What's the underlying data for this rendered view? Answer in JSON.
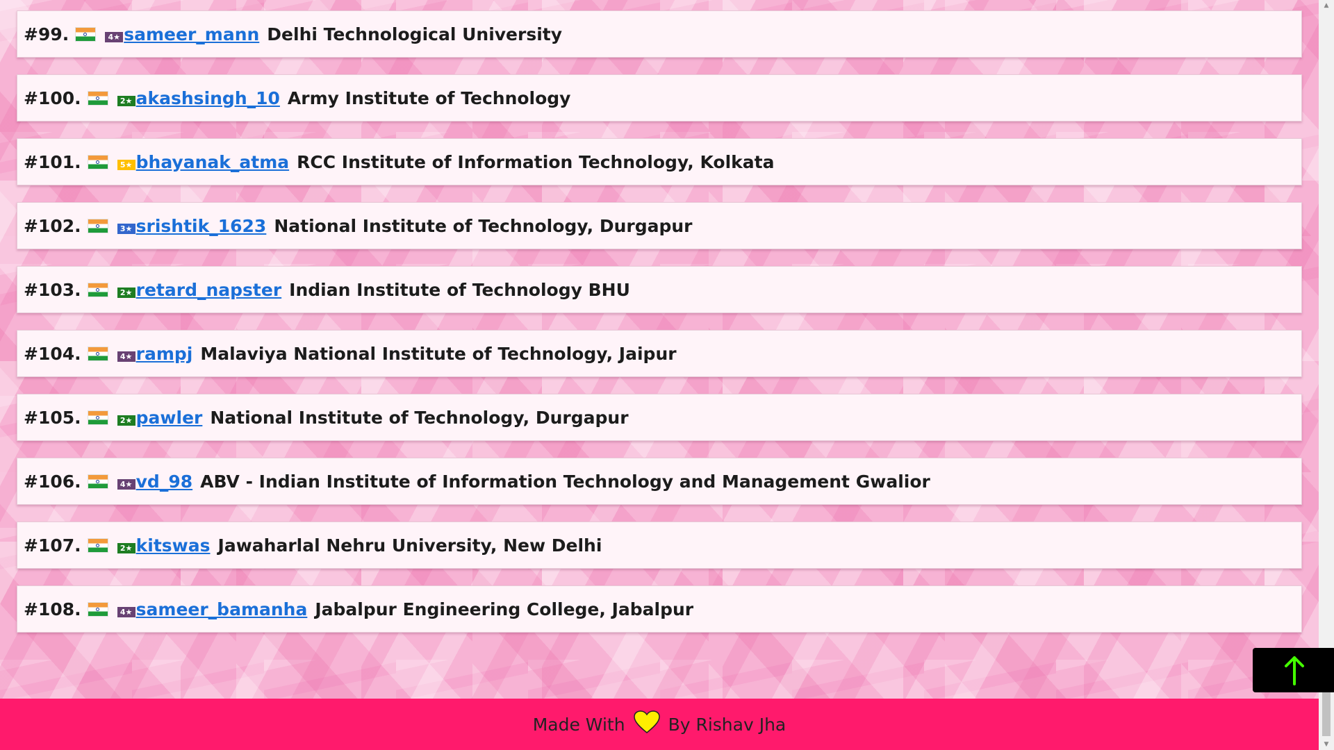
{
  "entries": [
    {
      "rank": "#99.",
      "stars": "4★",
      "star_color": "#684273",
      "username": "sameer_mann",
      "institution": "Delhi Technological University"
    },
    {
      "rank": "#100.",
      "stars": "2★",
      "star_color": "#1e7d22",
      "username": "akashsingh_10",
      "institution": "Army Institute of Technology"
    },
    {
      "rank": "#101.",
      "stars": "5★",
      "star_color": "#ffbf00",
      "username": "bhayanak_atma",
      "institution": "RCC Institute of Information Technology, Kolkata"
    },
    {
      "rank": "#102.",
      "stars": "3★",
      "star_color": "#3366cc",
      "username": "srishtik_1623",
      "institution": "National Institute of Technology, Durgapur"
    },
    {
      "rank": "#103.",
      "stars": "2★",
      "star_color": "#1e7d22",
      "username": "retard_napster",
      "institution": "Indian Institute of Technology BHU"
    },
    {
      "rank": "#104.",
      "stars": "4★",
      "star_color": "#684273",
      "username": "rampj",
      "institution": "Malaviya National Institute of Technology, Jaipur"
    },
    {
      "rank": "#105.",
      "stars": "2★",
      "star_color": "#1e7d22",
      "username": "pawler",
      "institution": "National Institute of Technology, Durgapur"
    },
    {
      "rank": "#106.",
      "stars": "4★",
      "star_color": "#684273",
      "username": "vd_98",
      "institution": "ABV - Indian Institute of Information Technology and Management Gwalior"
    },
    {
      "rank": "#107.",
      "stars": "2★",
      "star_color": "#1e7d22",
      "username": "kitswas",
      "institution": "Jawaharlal Nehru University, New Delhi"
    },
    {
      "rank": "#108.",
      "stars": "4★",
      "star_color": "#684273",
      "username": "sameer_bamanha",
      "institution": "Jabalpur Engineering College, Jabalpur"
    }
  ],
  "footer": {
    "made_with": "Made With",
    "by": "By Rishav Jha",
    "heart_color": "#ffee00"
  },
  "back_to_top": {
    "icon": "arrow-up-icon",
    "color": "#44ff00"
  },
  "colors": {
    "footer_bg": "#ff1a6c",
    "link": "#1a6fd8"
  }
}
